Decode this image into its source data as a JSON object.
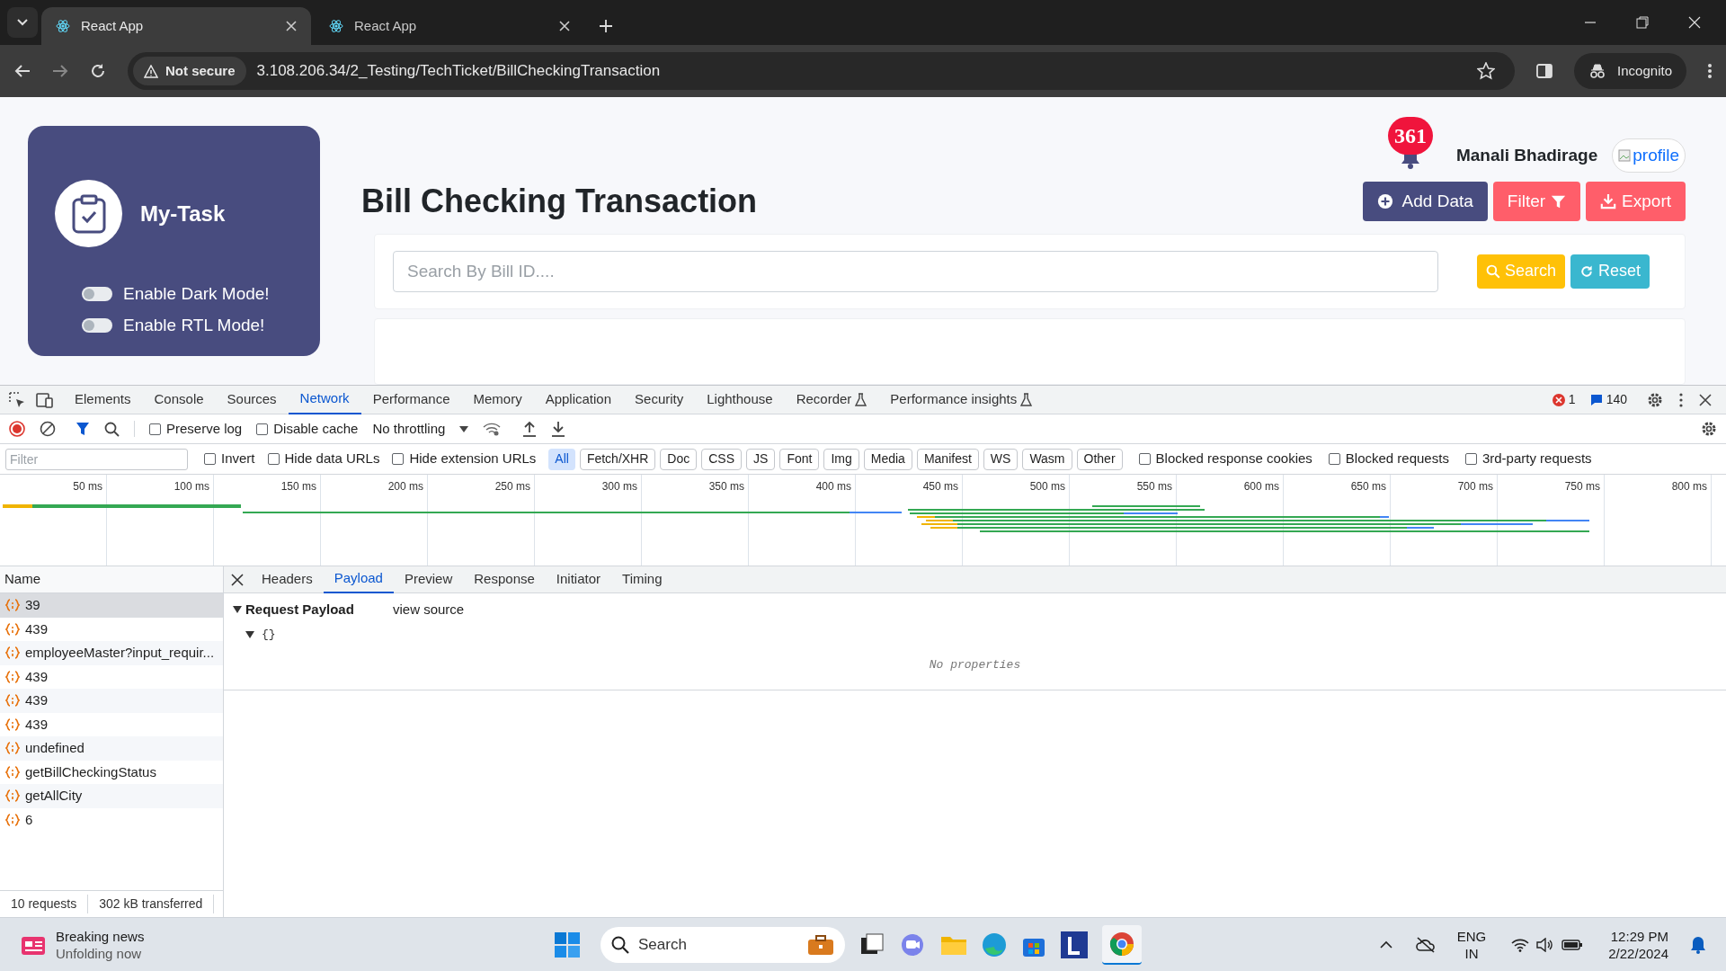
{
  "browser": {
    "tabs": [
      {
        "title": "React App",
        "selected": true
      },
      {
        "title": "React App",
        "selected": false
      }
    ],
    "address": {
      "security": "Not secure",
      "url": "3.108.206.34/2_Testing/TechTicket/BillCheckingTransaction"
    },
    "profile": "Incognito"
  },
  "app": {
    "sidebar": {
      "brand": "My-Task",
      "toggles": [
        {
          "label": "Enable Dark Mode!",
          "on": false
        },
        {
          "label": "Enable RTL Mode!",
          "on": false
        }
      ]
    },
    "header": {
      "notification_count": "361",
      "user_name": "Manali Bhadirage",
      "avatar_alt": "profile"
    },
    "title": "Bill Checking Transaction",
    "actions": [
      {
        "label": "Add Data",
        "kind": "add"
      },
      {
        "label": "Filter",
        "kind": "filter"
      },
      {
        "label": "Export",
        "kind": "export"
      }
    ],
    "search": {
      "placeholder": "Search By Bill ID...."
    },
    "search_buttons": [
      {
        "label": "Search",
        "kind": "search"
      },
      {
        "label": "Reset",
        "kind": "reset"
      }
    ]
  },
  "devtools": {
    "panels": [
      {
        "label": "Elements",
        "selected": false,
        "experimental": false
      },
      {
        "label": "Console",
        "selected": false,
        "experimental": false
      },
      {
        "label": "Sources",
        "selected": false,
        "experimental": false
      },
      {
        "label": "Network",
        "selected": true,
        "experimental": false
      },
      {
        "label": "Performance",
        "selected": false,
        "experimental": false
      },
      {
        "label": "Memory",
        "selected": false,
        "experimental": false
      },
      {
        "label": "Application",
        "selected": false,
        "experimental": false
      },
      {
        "label": "Security",
        "selected": false,
        "experimental": false
      },
      {
        "label": "Lighthouse",
        "selected": false,
        "experimental": false
      },
      {
        "label": "Recorder",
        "selected": false,
        "experimental": true
      },
      {
        "label": "Performance insights",
        "selected": false,
        "experimental": true
      }
    ],
    "error_count": "1",
    "message_count": "140",
    "toolbar": {
      "checkboxes": [
        {
          "label": "Preserve log",
          "checked": false
        },
        {
          "label": "Disable cache",
          "checked": false
        }
      ],
      "throttling": "No throttling"
    },
    "filter": {
      "placeholder": "Filter",
      "checkboxes": [
        {
          "label": "Invert",
          "checked": false
        },
        {
          "label": "Hide data URLs",
          "checked": false
        },
        {
          "label": "Hide extension URLs",
          "checked": false
        }
      ],
      "types": [
        {
          "label": "All",
          "selected": true
        },
        {
          "label": "Fetch/XHR",
          "selected": false
        },
        {
          "label": "Doc",
          "selected": false
        },
        {
          "label": "CSS",
          "selected": false
        },
        {
          "label": "JS",
          "selected": false
        },
        {
          "label": "Font",
          "selected": false
        },
        {
          "label": "Img",
          "selected": false
        },
        {
          "label": "Media",
          "selected": false
        },
        {
          "label": "Manifest",
          "selected": false
        },
        {
          "label": "WS",
          "selected": false
        },
        {
          "label": "Wasm",
          "selected": false
        },
        {
          "label": "Other",
          "selected": false
        }
      ],
      "more_checkboxes": [
        {
          "label": "Blocked response cookies",
          "checked": false
        },
        {
          "label": "Blocked requests",
          "checked": false
        },
        {
          "label": "3rd-party requests",
          "checked": false
        }
      ]
    },
    "timeline_ticks": [
      "50 ms",
      "100 ms",
      "150 ms",
      "200 ms",
      "250 ms",
      "300 ms",
      "350 ms",
      "400 ms",
      "450 ms",
      "500 ms",
      "550 ms",
      "600 ms",
      "650 ms",
      "700 ms",
      "750 ms",
      "800 ms"
    ],
    "name_header": "Name",
    "requests": [
      {
        "name": "39",
        "selected": true
      },
      {
        "name": "439",
        "selected": false
      },
      {
        "name": "employeeMaster?input_requir...",
        "selected": false
      },
      {
        "name": "439",
        "selected": false
      },
      {
        "name": "439",
        "selected": false
      },
      {
        "name": "439",
        "selected": false
      },
      {
        "name": "undefined",
        "selected": false
      },
      {
        "name": "getBillCheckingStatus",
        "selected": false
      },
      {
        "name": "getAllCity",
        "selected": false
      },
      {
        "name": "6",
        "selected": false
      }
    ],
    "detail_tabs": [
      {
        "label": "Headers",
        "selected": false
      },
      {
        "label": "Payload",
        "selected": true
      },
      {
        "label": "Preview",
        "selected": false
      },
      {
        "label": "Response",
        "selected": false
      },
      {
        "label": "Initiator",
        "selected": false
      },
      {
        "label": "Timing",
        "selected": false
      }
    ],
    "payload": {
      "title": "Request Payload",
      "view_source": "view source",
      "object": "{}",
      "empty": "No properties"
    },
    "status": [
      "10 requests",
      "302 kB transferred"
    ]
  },
  "taskbar": {
    "news": {
      "title": "Breaking news",
      "subtitle": "Unfolding now"
    },
    "search": "Search",
    "language": [
      "ENG",
      "IN"
    ],
    "time": "12:29 PM",
    "date": "2/22/2024"
  }
}
